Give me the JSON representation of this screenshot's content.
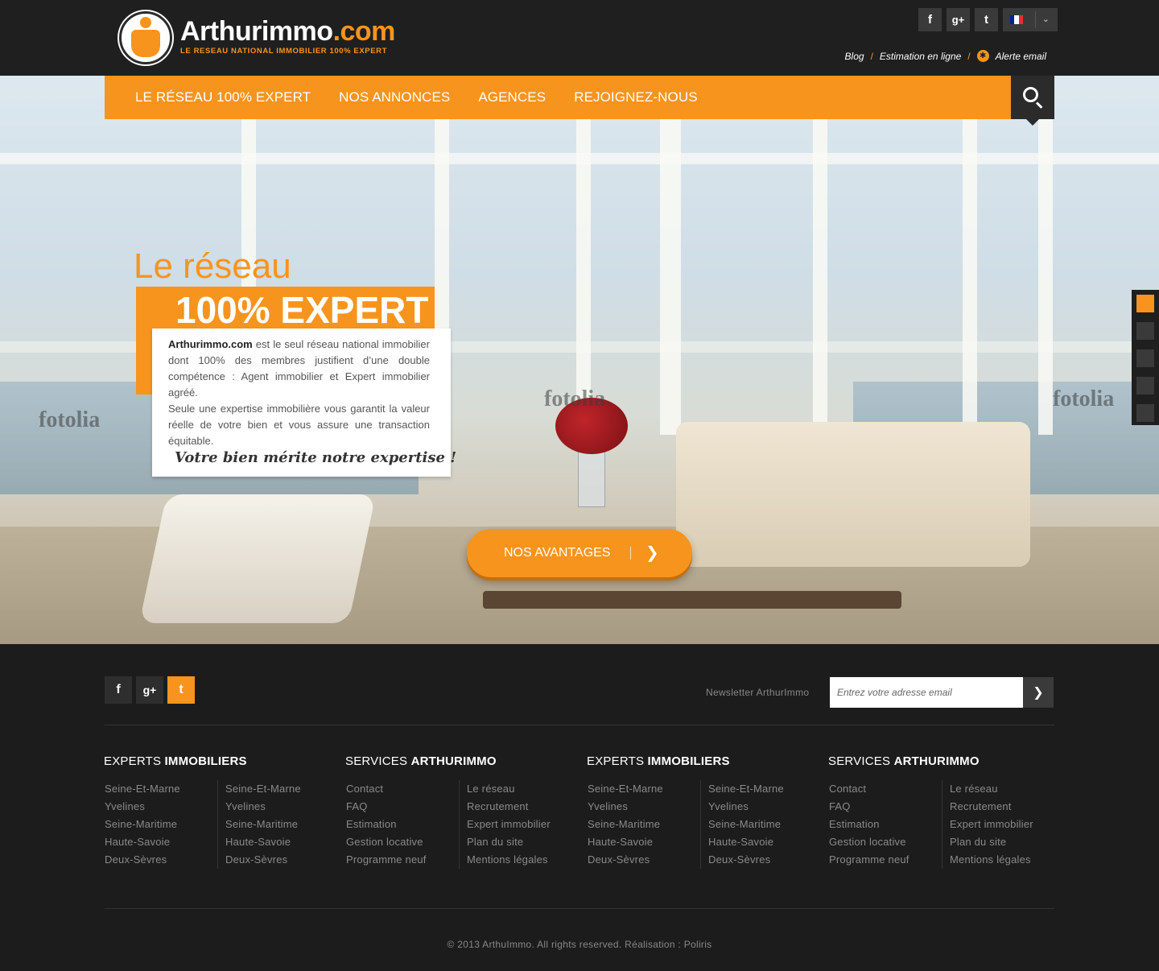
{
  "header": {
    "logo_name": "Arthurimmo",
    "logo_dotcom": ".com",
    "logo_tagline": "LE RESEAU NATIONAL IMMOBILIER 100% EXPERT",
    "social": [
      "f",
      "g+",
      "t"
    ],
    "links": {
      "blog": "Blog",
      "sep": "/",
      "estimation": "Estimation en ligne",
      "alerte": "Alerte email"
    },
    "language": {
      "flag_colors": [
        "#002395",
        "#ffffff",
        "#ed2939"
      ],
      "chevron": "⌄"
    }
  },
  "nav": {
    "items": [
      "LE RÉSEAU 100% EXPERT",
      "NOS ANNONCES",
      "AGENCES",
      "REJOIGNEZ-NOUS"
    ],
    "search_icon": "search-icon"
  },
  "hero": {
    "title1": "Le réseau",
    "title2": "100% EXPERT",
    "brand": "Arthurimmo.com",
    "text1": " est le seul réseau national immobilier dont 100% des membres justifient d’une double compétence : Agent immobilier et Expert immobilier agréé.",
    "text2": "Seule une expertise immobilière vous garantit la valeur réelle de votre bien et vous assure une transaction équitable.",
    "slogan": "Votre bien mérite notre expertise !",
    "cta_label": "NOS AVANTAGES",
    "cta_arrow": "❯",
    "watermark": "fotolia",
    "slider": {
      "count": 5,
      "active": 0
    }
  },
  "footer": {
    "social": [
      "f",
      "g+",
      "t"
    ],
    "newsletter_label": "Newsletter ArthurImmo",
    "newsletter_placeholder": "Entrez votre adresse email",
    "newsletter_arrow": "❯",
    "columns": [
      {
        "title_light": "EXPERTS ",
        "title_bold": "IMMOBILIERS",
        "lists": [
          [
            "Seine-Et-Marne",
            "Yvelines",
            "Seine-Maritime",
            "Haute-Savoie",
            "Deux-Sèvres"
          ],
          [
            "Seine-Et-Marne",
            "Yvelines",
            "Seine-Maritime",
            "Haute-Savoie",
            "Deux-Sèvres"
          ]
        ]
      },
      {
        "title_light": "SERVICES ",
        "title_bold": "ARTHURIMMO",
        "lists": [
          [
            "Contact",
            "FAQ",
            "Estimation",
            "Gestion locative",
            "Programme neuf"
          ],
          [
            "Le réseau",
            "Recrutement",
            "Expert immobilier",
            "Plan du site",
            "Mentions légales"
          ]
        ]
      },
      {
        "title_light": "EXPERTS ",
        "title_bold": "IMMOBILIERS",
        "lists": [
          [
            "Seine-Et-Marne",
            "Yvelines",
            "Seine-Maritime",
            "Haute-Savoie",
            "Deux-Sèvres"
          ],
          [
            "Seine-Et-Marne",
            "Yvelines",
            "Seine-Maritime",
            "Haute-Savoie",
            "Deux-Sèvres"
          ]
        ]
      },
      {
        "title_light": "SERVICES ",
        "title_bold": "ARTHURIMMO",
        "lists": [
          [
            "Contact",
            "FAQ",
            "Estimation",
            "Gestion locative",
            "Programme neuf"
          ],
          [
            "Le réseau",
            "Recrutement",
            "Expert immobilier",
            "Plan du site",
            "Mentions légales"
          ]
        ]
      }
    ],
    "copyright": "© 2013 ArthuImmo. All rights reserved. Réalisation : Poliris"
  },
  "colors": {
    "accent": "#f7941d",
    "dark": "#1c1c1c"
  }
}
